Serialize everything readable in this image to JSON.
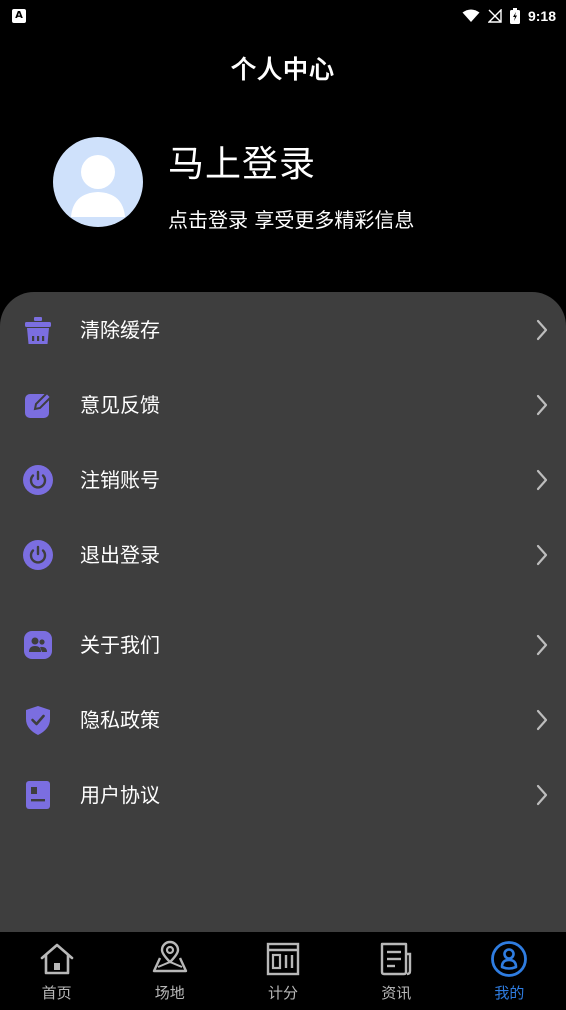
{
  "status_bar": {
    "time": "9:18"
  },
  "header": {
    "title": "个人中心"
  },
  "profile": {
    "login_title": "马上登录",
    "login_subtitle": "点击登录 享受更多精彩信息"
  },
  "menu": {
    "items": [
      {
        "label": "清除缓存",
        "icon": "trash-icon"
      },
      {
        "label": "意见反馈",
        "icon": "edit-icon"
      },
      {
        "label": "注销账号",
        "icon": "power-icon"
      },
      {
        "label": "退出登录",
        "icon": "power-icon"
      },
      {
        "label": "关于我们",
        "icon": "people-icon"
      },
      {
        "label": "隐私政策",
        "icon": "shield-check-icon"
      },
      {
        "label": "用户协议",
        "icon": "document-icon"
      }
    ]
  },
  "bottom_nav": {
    "items": [
      {
        "label": "首页",
        "icon": "home-icon"
      },
      {
        "label": "场地",
        "icon": "location-map-icon"
      },
      {
        "label": "计分",
        "icon": "scoreboard-icon"
      },
      {
        "label": "资讯",
        "icon": "news-icon"
      },
      {
        "label": "我的",
        "icon": "user-circle-icon"
      }
    ],
    "active_index": 4
  },
  "colors": {
    "background": "#000000",
    "card": "#3e3e3e",
    "accent": "#7b6ee0",
    "nav_active": "#2f7de1",
    "nav_inactive": "#b8b8b8",
    "avatar_bg": "#cfe1fb"
  }
}
